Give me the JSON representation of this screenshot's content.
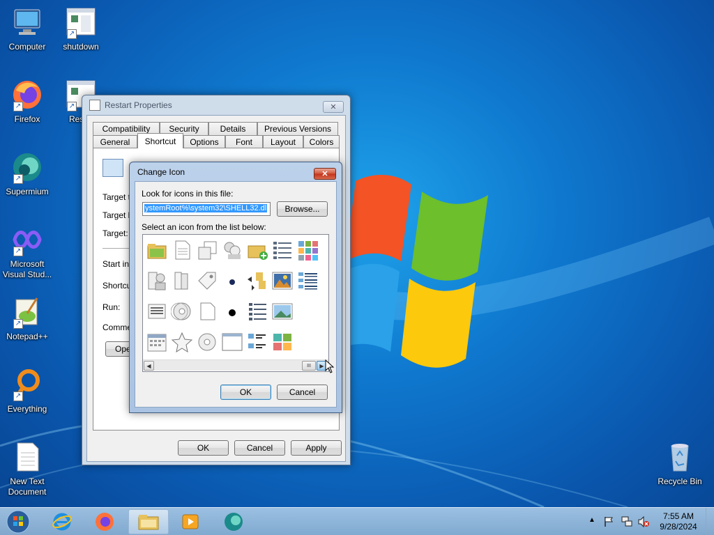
{
  "desktop": {
    "icons": [
      {
        "label": "Computer",
        "icon": "computer-icon"
      },
      {
        "label": "shutdown",
        "icon": "shortcut-icon"
      },
      {
        "label": "Firefox",
        "icon": "firefox-icon"
      },
      {
        "label": "Res",
        "icon": "shortcut-icon"
      },
      {
        "label": "Supermium",
        "icon": "supermium-icon"
      },
      {
        "label": "Microsoft Visual Stud...",
        "icon": "visual-studio-icon"
      },
      {
        "label": "Notepad++",
        "icon": "notepadpp-icon"
      },
      {
        "label": "Everything",
        "icon": "everything-icon"
      },
      {
        "label": "New Text Document",
        "icon": "text-document-icon"
      },
      {
        "label": "Recycle Bin",
        "icon": "recycle-bin-icon"
      }
    ]
  },
  "properties": {
    "title": "Restart Properties",
    "tabs_row1": [
      "Compatibility",
      "Security",
      "Details",
      "Previous Versions"
    ],
    "tabs_row2": [
      "General",
      "Shortcut",
      "Options",
      "Font",
      "Layout",
      "Colors"
    ],
    "selected_tab": "Shortcut",
    "fields": [
      "Target ty",
      "Target lo",
      "Target:",
      "Start in:",
      "Shortcut",
      "Run:",
      "Commen"
    ],
    "open_button": "Ope",
    "ok": "OK",
    "cancel": "Cancel",
    "apply": "Apply"
  },
  "change_icon": {
    "title": "Change Icon",
    "look_label": "Look for icons in this file:",
    "path_value": "ystemRoot%\\system32\\SHELL32.dll",
    "browse": "Browse...",
    "select_label": "Select an icon from the list below:",
    "ok": "OK",
    "cancel": "Cancel",
    "scroll_thumb": "III"
  },
  "taskbar": {
    "time": "7:55 AM",
    "date": "9/28/2024"
  },
  "colors": {
    "selection": "#3399ff",
    "desktop": "#0f79cf"
  }
}
